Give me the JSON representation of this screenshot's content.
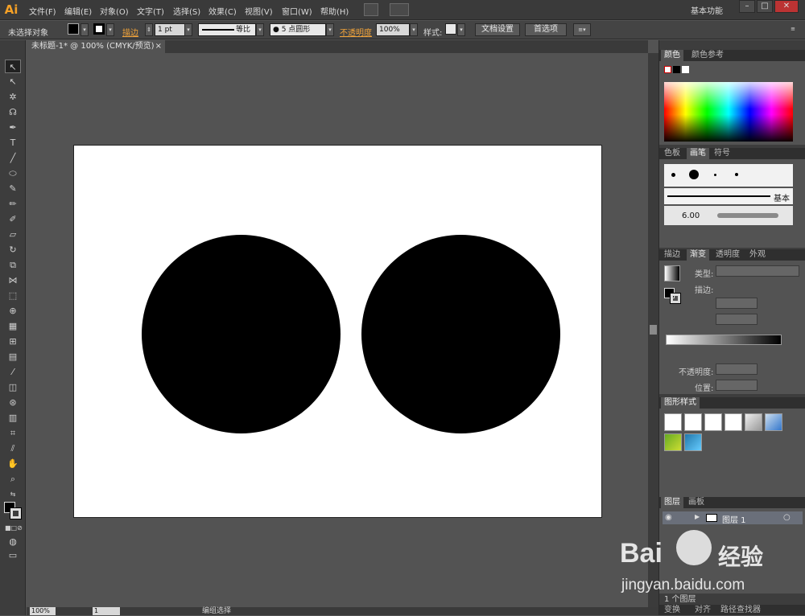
{
  "app": {
    "logo": "Ai",
    "workspace": "基本功能"
  },
  "menu": [
    "文件(F)",
    "编辑(E)",
    "对象(O)",
    "文字(T)",
    "选择(S)",
    "效果(C)",
    "视图(V)",
    "窗口(W)",
    "帮助(H)"
  ],
  "window_controls": {
    "minimize": "–",
    "restore": "□",
    "close": "✕"
  },
  "control_bar": {
    "selection": "未选择对象",
    "stroke_label": "描边",
    "stroke_weight": "1 pt",
    "stroke_profile": "等比",
    "brush": "● 5 点圆形",
    "opacity_label": "不透明度",
    "opacity_value": "100%",
    "style_label": "样式:",
    "doc_setup": "文档设置",
    "preferences": "首选项"
  },
  "document": {
    "tab": "未标题-1* @ 100% (CMYK/预览)",
    "close": "×"
  },
  "status": {
    "zoom": "100%",
    "artboard": "1",
    "tool_info": "编组选择"
  },
  "panels": {
    "color": {
      "tabs": [
        "颜色",
        "颜色参考"
      ]
    },
    "brushes": {
      "tabs": [
        "色板",
        "画笔",
        "符号"
      ],
      "basic": "基本",
      "size": "6.00"
    },
    "gradient": {
      "tabs": [
        "描边",
        "渐变",
        "透明度",
        "外观"
      ],
      "type_label": "类型:",
      "stroke_label": "描边:",
      "opacity_label": "不透明度:",
      "position_label": "位置:"
    },
    "graphic_styles": {
      "tabs": [
        "图形样式"
      ]
    },
    "layers": {
      "tabs": [
        "图层",
        "画板"
      ],
      "layer_name": "图层 1",
      "count": "1 个图层"
    },
    "bottom": {
      "tabs": [
        "变换",
        "对齐",
        "路径查找器"
      ]
    }
  },
  "watermark": {
    "brand": "Bai",
    "brand2": "经验",
    "url": "jingyan.baidu.com"
  },
  "colors": {
    "accent": "#f4a026",
    "artboard": "#ffffff",
    "shape": "#000000",
    "pasteboard": "#535353"
  }
}
